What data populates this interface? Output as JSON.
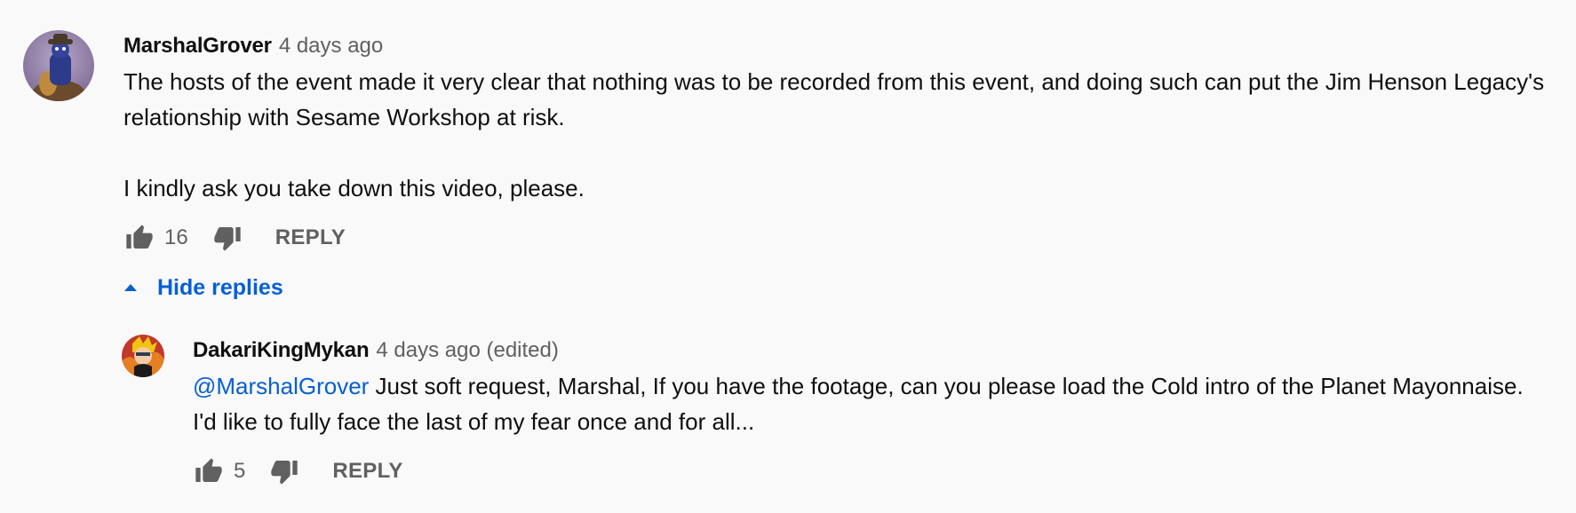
{
  "comment": {
    "author": "MarshalGrover",
    "time": "4 days ago",
    "text": "The hosts of the event made it very clear that nothing was to be recorded from this event, and doing such can put the Jim Henson Legacy's relationship with Sesame Workshop at risk.\n\nI kindly ask you take down this video, please.",
    "likes": "16",
    "reply_label": "REPLY",
    "avatar_icon": "user-avatar-icon"
  },
  "hide_replies": {
    "label": "Hide replies",
    "icon": "caret-up-icon"
  },
  "reply": {
    "author": "DakariKingMykan",
    "time": "4 days ago (edited)",
    "mention": "@MarshalGrover",
    "text": " Just soft request, Marshal, If you have the footage, can you please load the Cold intro of the Planet Mayonnaise. I'd like to fully face the last of my fear once and for all...",
    "likes": "5",
    "reply_label": "REPLY",
    "avatar_icon": "user-avatar-icon"
  },
  "colors": {
    "link": "#065fd4",
    "secondary_text": "#606060",
    "background": "#f9f9f9"
  }
}
